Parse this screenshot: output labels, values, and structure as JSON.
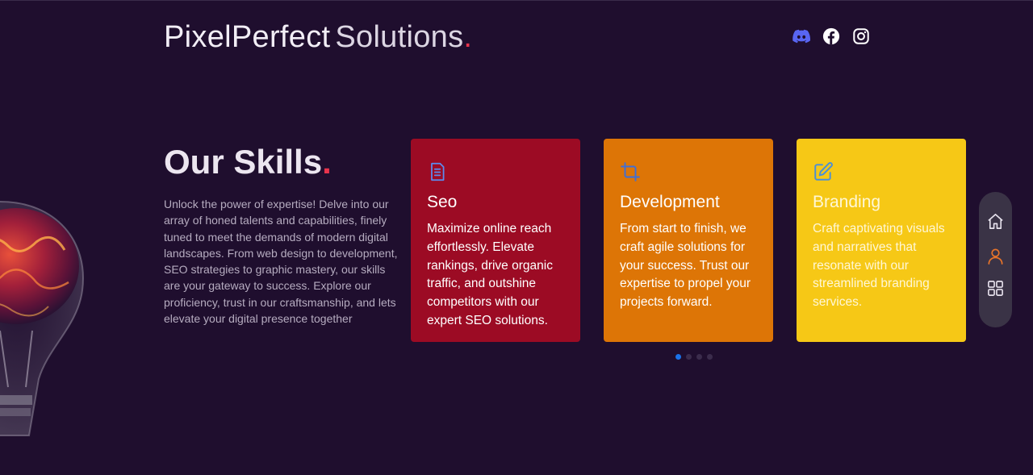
{
  "header": {
    "brand_bold": "PixelPerfect",
    "brand_light": "Solutions",
    "brand_dot": ".",
    "socials": [
      {
        "icon": "discord-icon",
        "color": "#5865f2"
      },
      {
        "icon": "facebook-icon",
        "color": "#ffffff"
      },
      {
        "icon": "instagram-icon",
        "color": "#ffffff"
      }
    ]
  },
  "intro": {
    "title": "Our Skills",
    "title_dot": ".",
    "description": "Unlock the power of expertise! Delve into our array of honed talents and capabilities, finely tuned to meet the demands of modern digital landscapes. From web design to development, SEO strategies to graphic mastery, our skills are your gateway to success. Explore our proficiency, trust in our craftsmanship, and lets elevate your digital presence together"
  },
  "cards": [
    {
      "icon": "document-icon",
      "title": "Seo",
      "text": "Maximize online reach effortlessly. Elevate rankings, drive organic traffic, and outshine competitors with our expert SEO solutions.",
      "color": "#9c0b24"
    },
    {
      "icon": "crop-icon",
      "title": "Development",
      "text": "From start to finish, we craft agile solutions for your success. Trust our expertise to propel your projects forward.",
      "color": "#dd7506"
    },
    {
      "icon": "edit-icon",
      "title": "Branding",
      "text": "Craft captivating visuals and narratives that resonate with our streamlined branding services.",
      "color": "#f6c816"
    }
  ],
  "pagination": {
    "pages": 4,
    "active": 1,
    "active_color": "#1a72e8"
  },
  "sidenav": {
    "items": [
      {
        "icon": "home-icon",
        "active": false
      },
      {
        "icon": "user-icon",
        "active": true
      },
      {
        "icon": "grid-icon",
        "active": false
      }
    ],
    "accent": "#e6732a"
  },
  "colors": {
    "background": "#1f0e2e",
    "accent_dot": "#e8344c"
  }
}
